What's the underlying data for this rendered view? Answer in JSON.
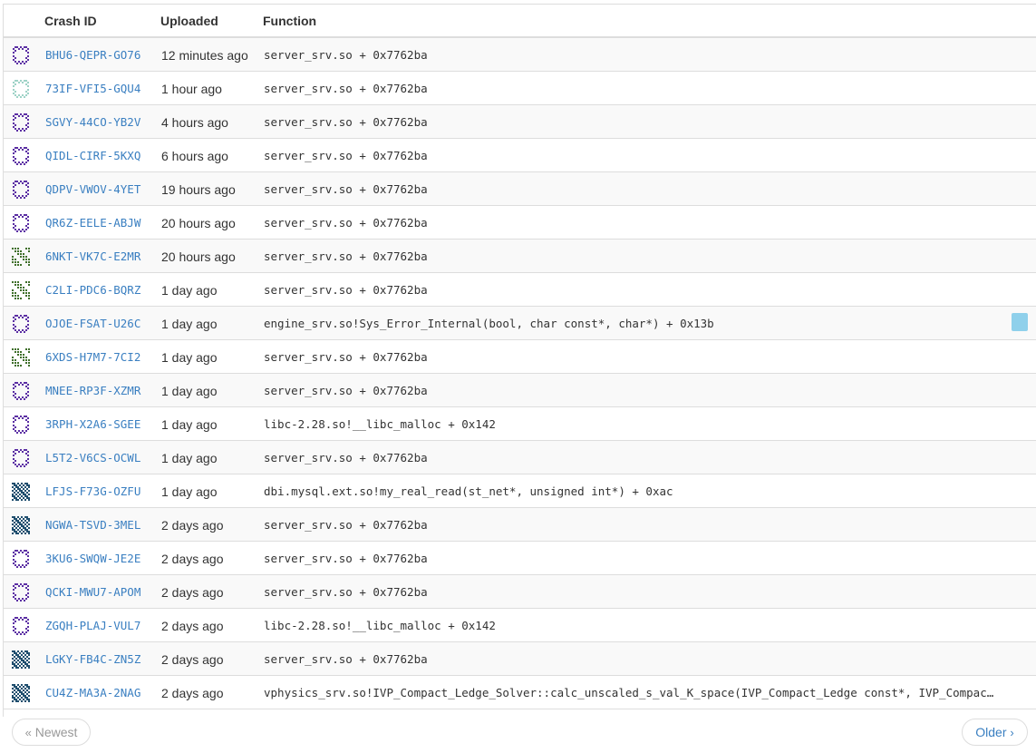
{
  "table": {
    "headers": {
      "crash_id": "Crash ID",
      "uploaded": "Uploaded",
      "function": "Function"
    },
    "rows": [
      {
        "id": "BHU6-QEPR-GO76",
        "uploaded": "12 minutes ago",
        "function": "server_srv.so + 0x7762ba",
        "avatar": "ring",
        "color": "#5b2fa3"
      },
      {
        "id": "73IF-VFI5-GQU4",
        "uploaded": "1 hour ago",
        "function": "server_srv.so + 0x7762ba",
        "avatar": "ring",
        "color": "#9fd3c7"
      },
      {
        "id": "SGVY-44CO-YB2V",
        "uploaded": "4 hours ago",
        "function": "server_srv.so + 0x7762ba",
        "avatar": "ring",
        "color": "#5b2fa3"
      },
      {
        "id": "QIDL-CIRF-5KXQ",
        "uploaded": "6 hours ago",
        "function": "server_srv.so + 0x7762ba",
        "avatar": "ring",
        "color": "#5b2fa3"
      },
      {
        "id": "QDPV-VWOV-4YET",
        "uploaded": "19 hours ago",
        "function": "server_srv.so + 0x7762ba",
        "avatar": "ring",
        "color": "#5b2fa3"
      },
      {
        "id": "QR6Z-EELE-ABJW",
        "uploaded": "20 hours ago",
        "function": "server_srv.so + 0x7762ba",
        "avatar": "ring",
        "color": "#5b2fa3"
      },
      {
        "id": "6NKT-VK7C-E2MR",
        "uploaded": "20 hours ago",
        "function": "server_srv.so + 0x7762ba",
        "avatar": "grid",
        "color": "#3f6f2a"
      },
      {
        "id": "C2LI-PDC6-BQRZ",
        "uploaded": "1 day ago",
        "function": "server_srv.so + 0x7762ba",
        "avatar": "grid",
        "color": "#3f6f2a"
      },
      {
        "id": "OJOE-FSAT-U26C",
        "uploaded": "1 day ago",
        "function": "engine_srv.so!Sys_Error_Internal(bool, char const*, char*) + 0x13b",
        "avatar": "ring",
        "color": "#5b2fa3",
        "marker": true
      },
      {
        "id": "6XDS-H7M7-7CI2",
        "uploaded": "1 day ago",
        "function": "server_srv.so + 0x7762ba",
        "avatar": "grid",
        "color": "#3f6f2a"
      },
      {
        "id": "MNEE-RP3F-XZMR",
        "uploaded": "1 day ago",
        "function": "server_srv.so + 0x7762ba",
        "avatar": "ring",
        "color": "#5b2fa3"
      },
      {
        "id": "3RPH-X2A6-SGEE",
        "uploaded": "1 day ago",
        "function": "libc-2.28.so!__libc_malloc + 0x142",
        "avatar": "ring",
        "color": "#5b2fa3"
      },
      {
        "id": "L5T2-V6CS-OCWL",
        "uploaded": "1 day ago",
        "function": "server_srv.so + 0x7762ba",
        "avatar": "ring",
        "color": "#5b2fa3"
      },
      {
        "id": "LFJS-F73G-OZFU",
        "uploaded": "1 day ago",
        "function": "dbi.mysql.ext.so!my_real_read(st_net*, unsigned int*) + 0xac",
        "avatar": "dense",
        "color": "#1f4e6e"
      },
      {
        "id": "NGWA-TSVD-3MEL",
        "uploaded": "2 days ago",
        "function": "server_srv.so + 0x7762ba",
        "avatar": "dense",
        "color": "#1f4e6e"
      },
      {
        "id": "3KU6-SWQW-JE2E",
        "uploaded": "2 days ago",
        "function": "server_srv.so + 0x7762ba",
        "avatar": "ring",
        "color": "#5b2fa3"
      },
      {
        "id": "QCKI-MWU7-APOM",
        "uploaded": "2 days ago",
        "function": "server_srv.so + 0x7762ba",
        "avatar": "ring",
        "color": "#5b2fa3"
      },
      {
        "id": "ZGQH-PLAJ-VUL7",
        "uploaded": "2 days ago",
        "function": "libc-2.28.so!__libc_malloc + 0x142",
        "avatar": "ring",
        "color": "#5b2fa3"
      },
      {
        "id": "LGKY-FB4C-ZN5Z",
        "uploaded": "2 days ago",
        "function": "server_srv.so + 0x7762ba",
        "avatar": "dense",
        "color": "#1f4e6e"
      },
      {
        "id": "CU4Z-MA3A-2NAG",
        "uploaded": "2 days ago",
        "function": "vphysics_srv.so!IVP_Compact_Ledge_Solver::calc_unscaled_s_val_K_space(IVP_Compact_Ledge const*, IVP_Compact_Triangle const*)",
        "avatar": "dense",
        "color": "#1f4e6e"
      }
    ]
  },
  "pagination": {
    "newest_label": "Newest",
    "older_label": "Older"
  },
  "colors": {
    "link": "#3a7fc1",
    "marker": "#8fd0eb"
  }
}
